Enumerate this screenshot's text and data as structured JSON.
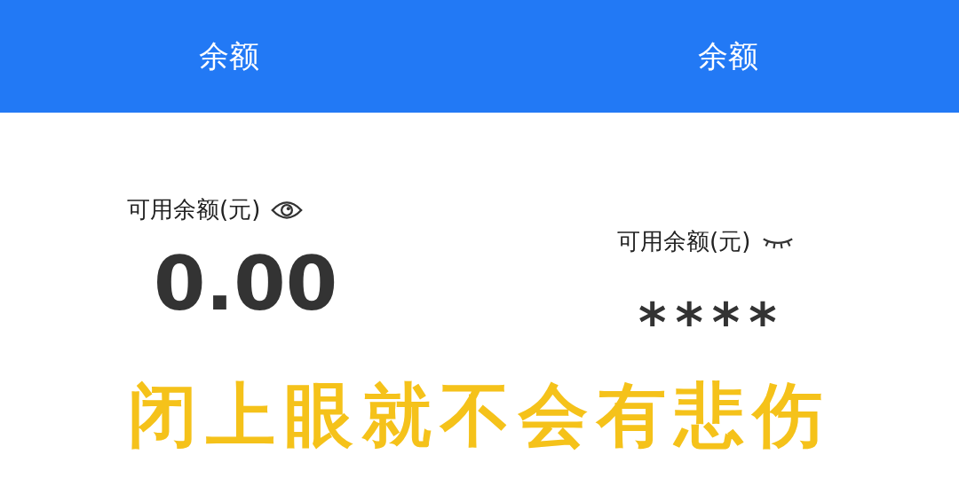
{
  "panels": [
    {
      "title": "余额",
      "label": "可用余额(元)",
      "visible": true,
      "amount": "0.00"
    },
    {
      "title": "余额",
      "label": "可用余额(元)",
      "visible": false,
      "amount": "****"
    }
  ],
  "caption": "闭上眼就不会有悲伤"
}
